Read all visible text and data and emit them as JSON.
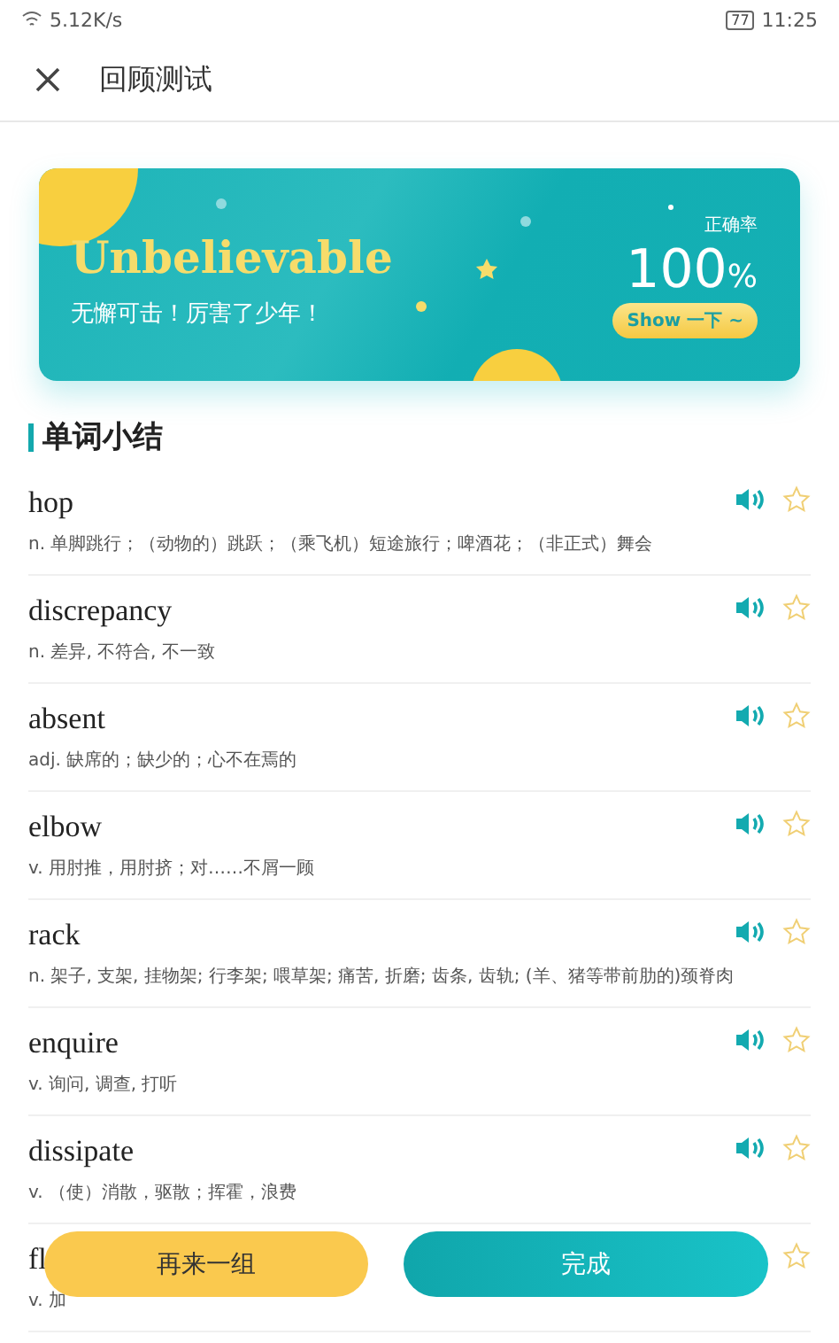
{
  "status_bar": {
    "speed": "5.12K/s",
    "battery": "77",
    "time": "11:25"
  },
  "header": {
    "title": "回顾测试"
  },
  "banner": {
    "headline": "Unbelievable",
    "subtitle": "无懈可击！厉害了少年！",
    "rate_label": "正确率",
    "rate": "100",
    "rate_unit": "%",
    "share_button": "Show 一下 ~"
  },
  "section_title": "单词小结",
  "words": [
    {
      "word": "hop",
      "meaning": "n. 单脚跳行；（动物的）跳跃；（乘飞机）短途旅行；啤酒花；（非正式）舞会",
      "starred": false,
      "audio": true
    },
    {
      "word": "discrepancy",
      "meaning": "n. 差异, 不符合, 不一致",
      "starred": false,
      "audio": true
    },
    {
      "word": "absent",
      "meaning": "adj. 缺席的；缺少的；心不在焉的",
      "starred": false,
      "audio": true
    },
    {
      "word": "elbow",
      "meaning": "v. 用肘推，用肘挤；对……不屑一顾",
      "starred": false,
      "audio": true
    },
    {
      "word": "rack",
      "meaning": "n. 架子, 支架, 挂物架; 行李架; 喂草架; 痛苦, 折磨; 齿条, 齿轨; (羊、猪等带前肋的)颈脊肉",
      "starred": false,
      "audio": true
    },
    {
      "word": "enquire",
      "meaning": "v. 询问, 调查, 打听",
      "starred": false,
      "audio": true
    },
    {
      "word": "dissipate",
      "meaning": "v. （使）消散，驱散；挥霍，浪费",
      "starred": false,
      "audio": true
    },
    {
      "word": "fl",
      "meaning": "v. 加",
      "starred": false,
      "audio": false
    }
  ],
  "buttons": {
    "again": "再来一组",
    "done": "完成"
  }
}
